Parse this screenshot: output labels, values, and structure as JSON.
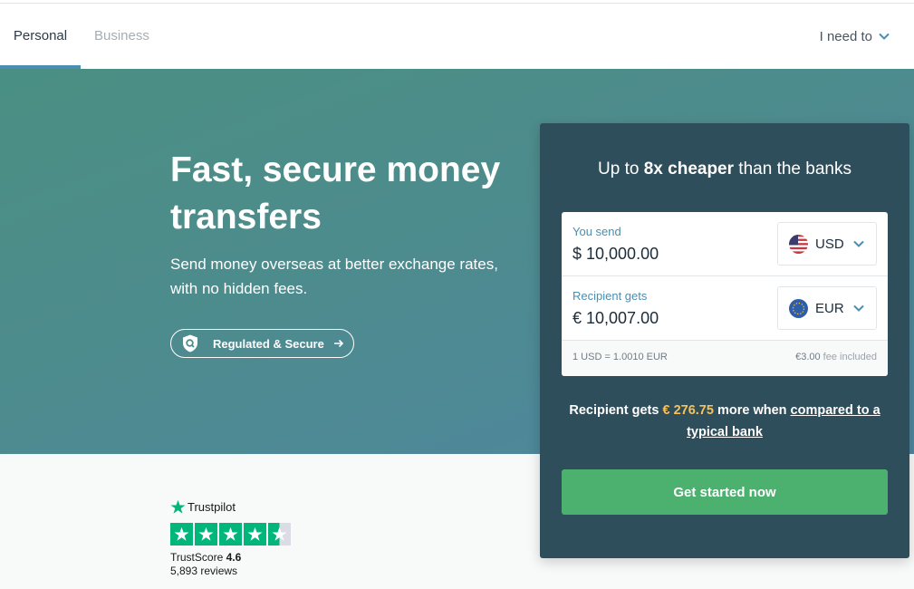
{
  "nav": {
    "tabs": [
      {
        "label": "Personal",
        "active": true
      },
      {
        "label": "Business",
        "active": false
      }
    ],
    "need_to": "I need to"
  },
  "hero": {
    "title": "Fast, secure money transfers",
    "subtitle": "Send money overseas at better exchange rates, with no hidden fees.",
    "regulated_button": "Regulated & Secure"
  },
  "calculator": {
    "headline_prefix": "Up to ",
    "headline_bold": "8x cheaper",
    "headline_suffix": " than the banks",
    "send": {
      "label": "You send",
      "value": "$ 10,000.00",
      "currency": "USD"
    },
    "receive": {
      "label": "Recipient gets",
      "value": "€ 10,007.00",
      "currency": "EUR"
    },
    "rate": "1 USD = 1.0010 EUR",
    "fee_amount": "€3.00",
    "fee_text": " fee included",
    "savings_prefix": "Recipient gets ",
    "savings_amount": "€ 276.75",
    "savings_middle": " more when ",
    "savings_link": "compared to a typical bank",
    "cta": "Get started now"
  },
  "trustpilot": {
    "brand": "Trustpilot",
    "score_label": "TrustScore",
    "score": "4.6",
    "reviews": "5,893 reviews",
    "stars": 4.5
  },
  "colors": {
    "accent": "#4a8fb0",
    "cta_green": "#4cb06f",
    "savings_gold": "#f6c25b",
    "trustpilot_green": "#00b67a",
    "calc_bg": "#2f4e5c"
  },
  "icons": [
    "chevron-down-icon",
    "shield-icon",
    "arrow-right-icon",
    "trustpilot-star-icon",
    "us-flag-icon",
    "eu-flag-icon"
  ]
}
